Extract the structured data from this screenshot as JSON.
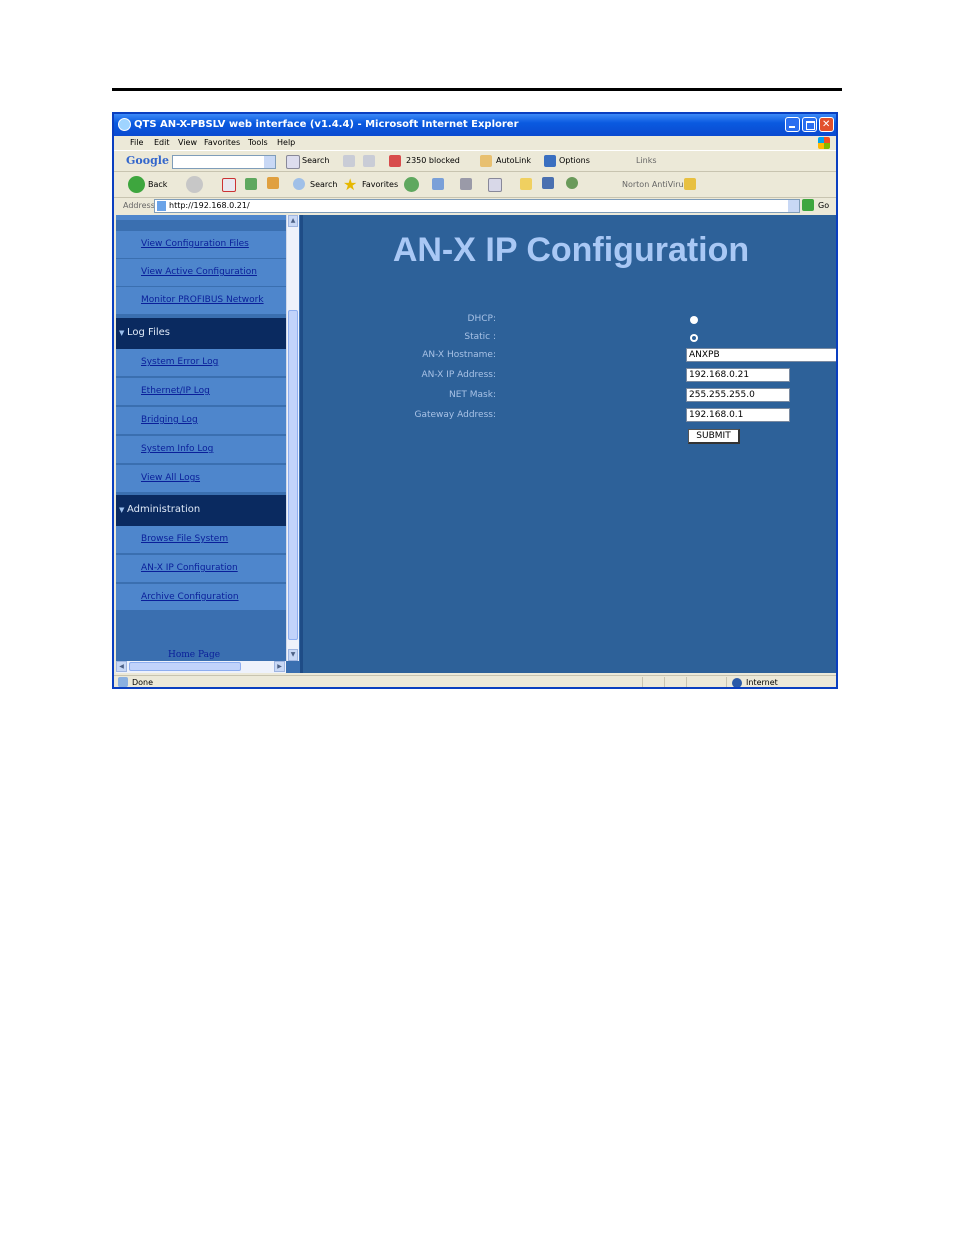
{
  "window": {
    "title": "QTS AN-X-PBSLV web interface (v1.4.4) - Microsoft Internet Explorer"
  },
  "menu": [
    "File",
    "Edit",
    "View",
    "Favorites",
    "Tools",
    "Help"
  ],
  "google_toolbar": {
    "logo": "Google",
    "search_label": "Search",
    "blocked_label": "2350 blocked",
    "autolink_label": "AutoLink",
    "options_label": "Options",
    "links_label": "Links"
  },
  "standard_toolbar": {
    "back_label": "Back",
    "search_label": "Search",
    "favorites_label": "Favorites",
    "norton_label": "Norton AntiVirus"
  },
  "address_bar": {
    "label": "Address",
    "url": "http://192.168.0.21/",
    "go_label": "Go"
  },
  "sidebar": {
    "items_top": [
      "View Configuration Files",
      "View Active Configuration",
      "Monitor PROFIBUS Network"
    ],
    "section_log": "Log Files",
    "items_log": [
      "System Error Log",
      "Ethernet/IP Log",
      "Bridging Log",
      "System Info Log",
      "View All Logs"
    ],
    "section_admin": "Administration",
    "items_admin": [
      "Browse File System",
      "AN-X IP Configuration",
      "Archive Configuration"
    ],
    "footer_link": "Home Page"
  },
  "content": {
    "title": "AN-X IP Configuration",
    "dhcp_label": "DHCP:",
    "static_label": "Static :",
    "selected_mode": "Static",
    "hostname_label": "AN-X Hostname:",
    "hostname_value": "ANXPB",
    "ip_label": "AN-X IP Address:",
    "ip_value": "192.168.0.21",
    "mask_label": "NET Mask:",
    "mask_value": "255.255.255.0",
    "gateway_label": "Gateway Address:",
    "gateway_value": "192.168.0.1",
    "submit_label": "SUBMIT"
  },
  "status_bar": {
    "status": "Done",
    "zone": "Internet"
  },
  "colors": {
    "nav_item": "#4e86cc",
    "nav_header": "#0a2a60",
    "content_bg": "#2d6199",
    "title_text": "#a9c8f5"
  }
}
